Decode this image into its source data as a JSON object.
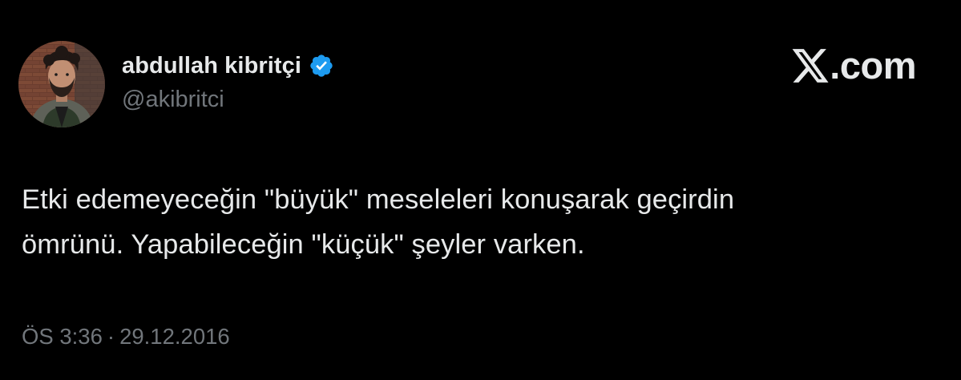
{
  "author": {
    "display_name": "abdullah kibritçi",
    "handle": "@akibritci",
    "verified_icon": "verified-badge-icon",
    "verified_color": "#1d9bf0"
  },
  "brand": {
    "icon": "x-logo-icon",
    "domain": ".com"
  },
  "tweet": {
    "lines": [
      "Etki edemeyeceğin \"büyük\" meseleleri konuşarak geçirdin",
      "ömrünü. Yapabileceğin \"küçük\" şeyler varken."
    ]
  },
  "meta": {
    "time": "ÖS 3:36",
    "separator": "·",
    "date": "29.12.2016"
  },
  "colors": {
    "background": "#000000",
    "primary_text": "#e7e9ea",
    "secondary_text": "#71767b"
  }
}
